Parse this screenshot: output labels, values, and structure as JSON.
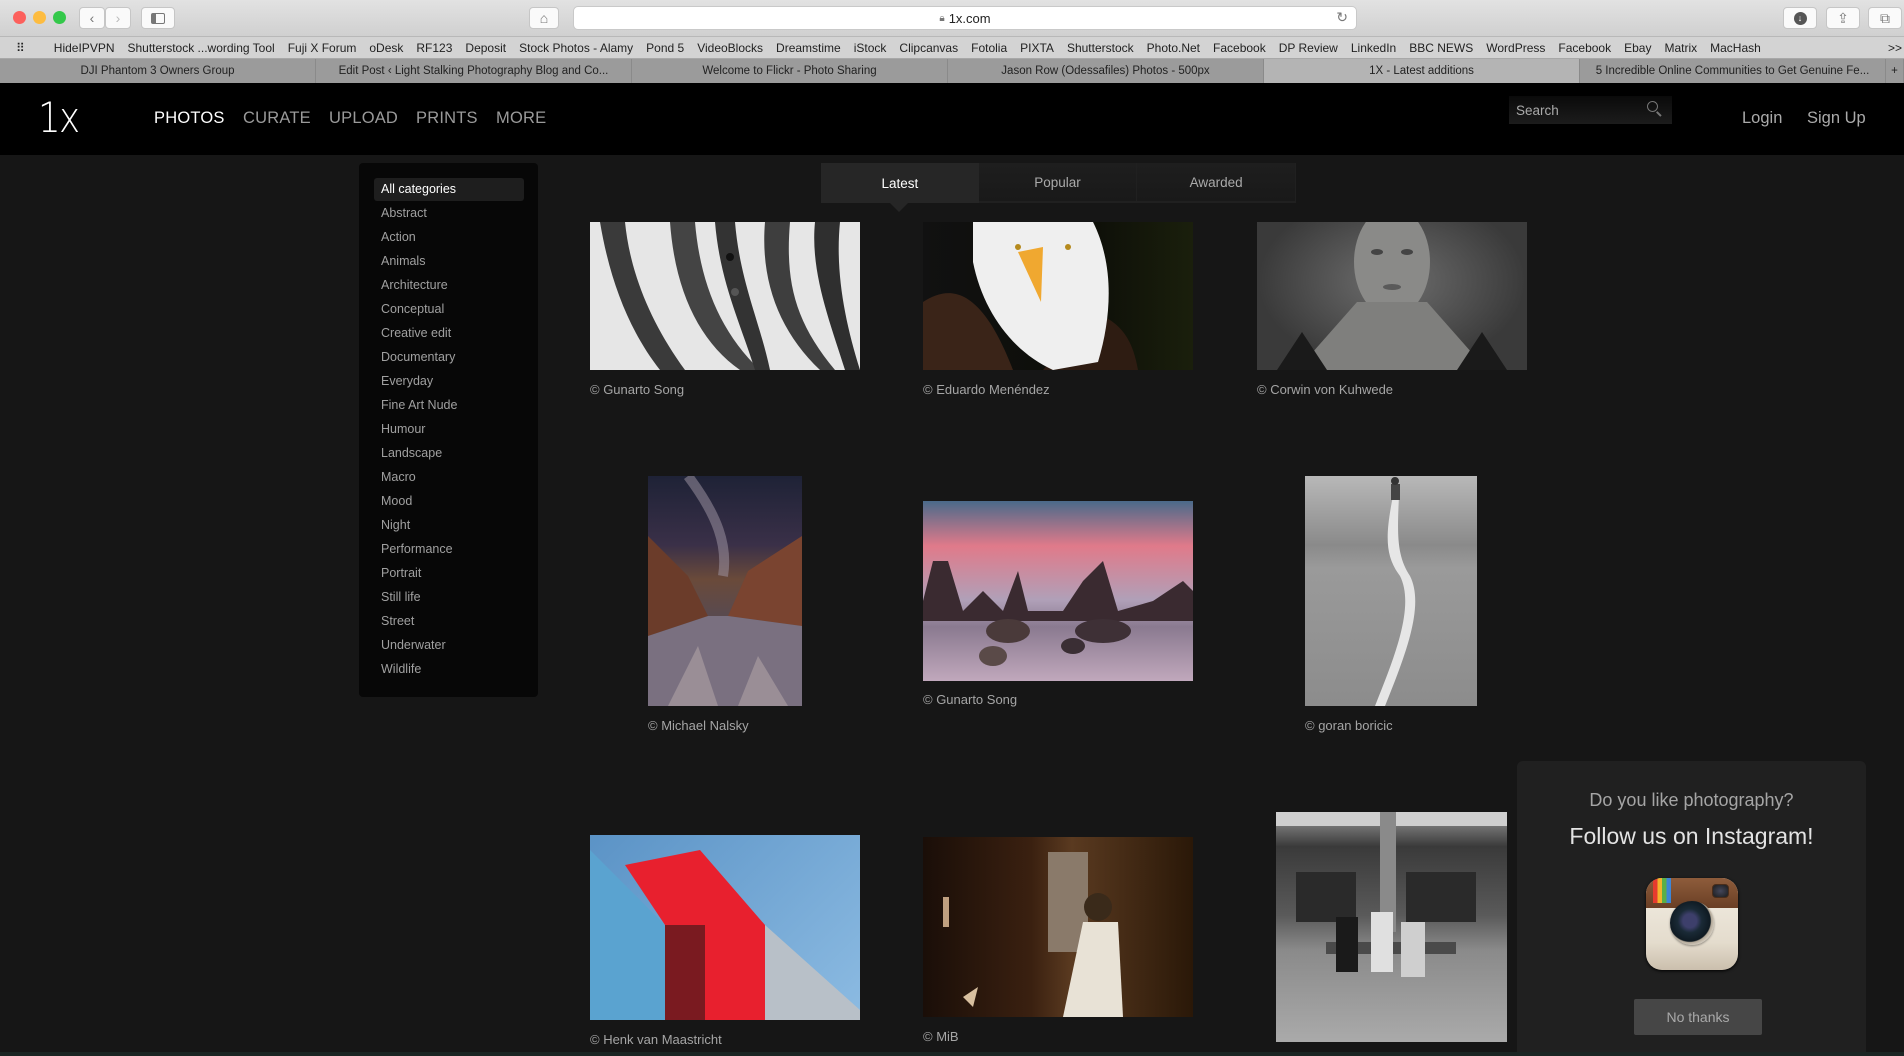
{
  "browser": {
    "url": "1x.com",
    "bookmarks": [
      "HideIPVPN",
      "Shutterstock ...wording Tool",
      "Fuji X Forum",
      "oDesk",
      "RF123",
      "Deposit",
      "Stock Photos - Alamy",
      "Pond 5",
      "VideoBlocks",
      "Dreamstime",
      "iStock",
      "Clipcanvas",
      "Fotolia",
      "PIXTA",
      "Shutterstock",
      "Photo.Net",
      "Facebook",
      "DP Review",
      "LinkedIn",
      "BBC NEWS",
      "WordPress",
      "Facebook",
      "Ebay",
      "Matrix",
      "MacHash"
    ],
    "bookmarks_overflow": ">>",
    "tabs": [
      {
        "title": "DJI Phantom 3 Owners Group",
        "active": false
      },
      {
        "title": "Edit Post ‹ Light Stalking Photography Blog and Co...",
        "active": false
      },
      {
        "title": "Welcome to Flickr - Photo Sharing",
        "active": false
      },
      {
        "title": "Jason Row (Odessafiles) Photos - 500px",
        "active": false
      },
      {
        "title": "1X - Latest additions",
        "active": true
      },
      {
        "title": "5 Incredible Online Communities to Get Genuine Fe...",
        "active": false
      }
    ],
    "new_tab": "+"
  },
  "site": {
    "logo": "1x",
    "nav": [
      {
        "label": "PHOTOS",
        "active": true
      },
      {
        "label": "CURATE",
        "active": false
      },
      {
        "label": "UPLOAD",
        "active": false
      },
      {
        "label": "PRINTS",
        "active": false
      },
      {
        "label": "MORE",
        "active": false
      }
    ],
    "search_placeholder": "Search",
    "login": "Login",
    "signup": "Sign Up"
  },
  "categories": [
    "All categories",
    "Abstract",
    "Action",
    "Animals",
    "Architecture",
    "Conceptual",
    "Creative edit",
    "Documentary",
    "Everyday",
    "Fine Art Nude",
    "Humour",
    "Landscape",
    "Macro",
    "Mood",
    "Night",
    "Performance",
    "Portrait",
    "Still life",
    "Street",
    "Underwater",
    "Wildlife"
  ],
  "active_category": "All categories",
  "sort_tabs": [
    {
      "label": "Latest",
      "active": true
    },
    {
      "label": "Popular",
      "active": false
    },
    {
      "label": "Awarded",
      "active": false
    }
  ],
  "photos": [
    {
      "credit": "© Gunarto Song",
      "subject": "black-and-white abstract stripes with climbing animals"
    },
    {
      "credit": "© Eduardo Menéndez",
      "subject": "bald eagle portrait"
    },
    {
      "credit": "© Corwin von Kuhwede",
      "subject": "black-and-white woman portrait"
    },
    {
      "credit": "© Michael Nalsky",
      "subject": "milky way over canyon"
    },
    {
      "credit": "© Gunarto Song",
      "subject": "rocky seascape at pink sunset"
    },
    {
      "credit": "© goran boricic",
      "subject": "person walking on white line"
    },
    {
      "credit": "© Henk van Maastricht",
      "subject": "red and blue architecture"
    },
    {
      "credit": "© MiB",
      "subject": "woman in white dress in wooden interior"
    },
    {
      "credit": "",
      "subject": "three men on bench, black-and-white street"
    }
  ],
  "popup": {
    "question": "Do you like photography?",
    "follow": "Follow us on Instagram!",
    "dismiss": "No thanks"
  }
}
